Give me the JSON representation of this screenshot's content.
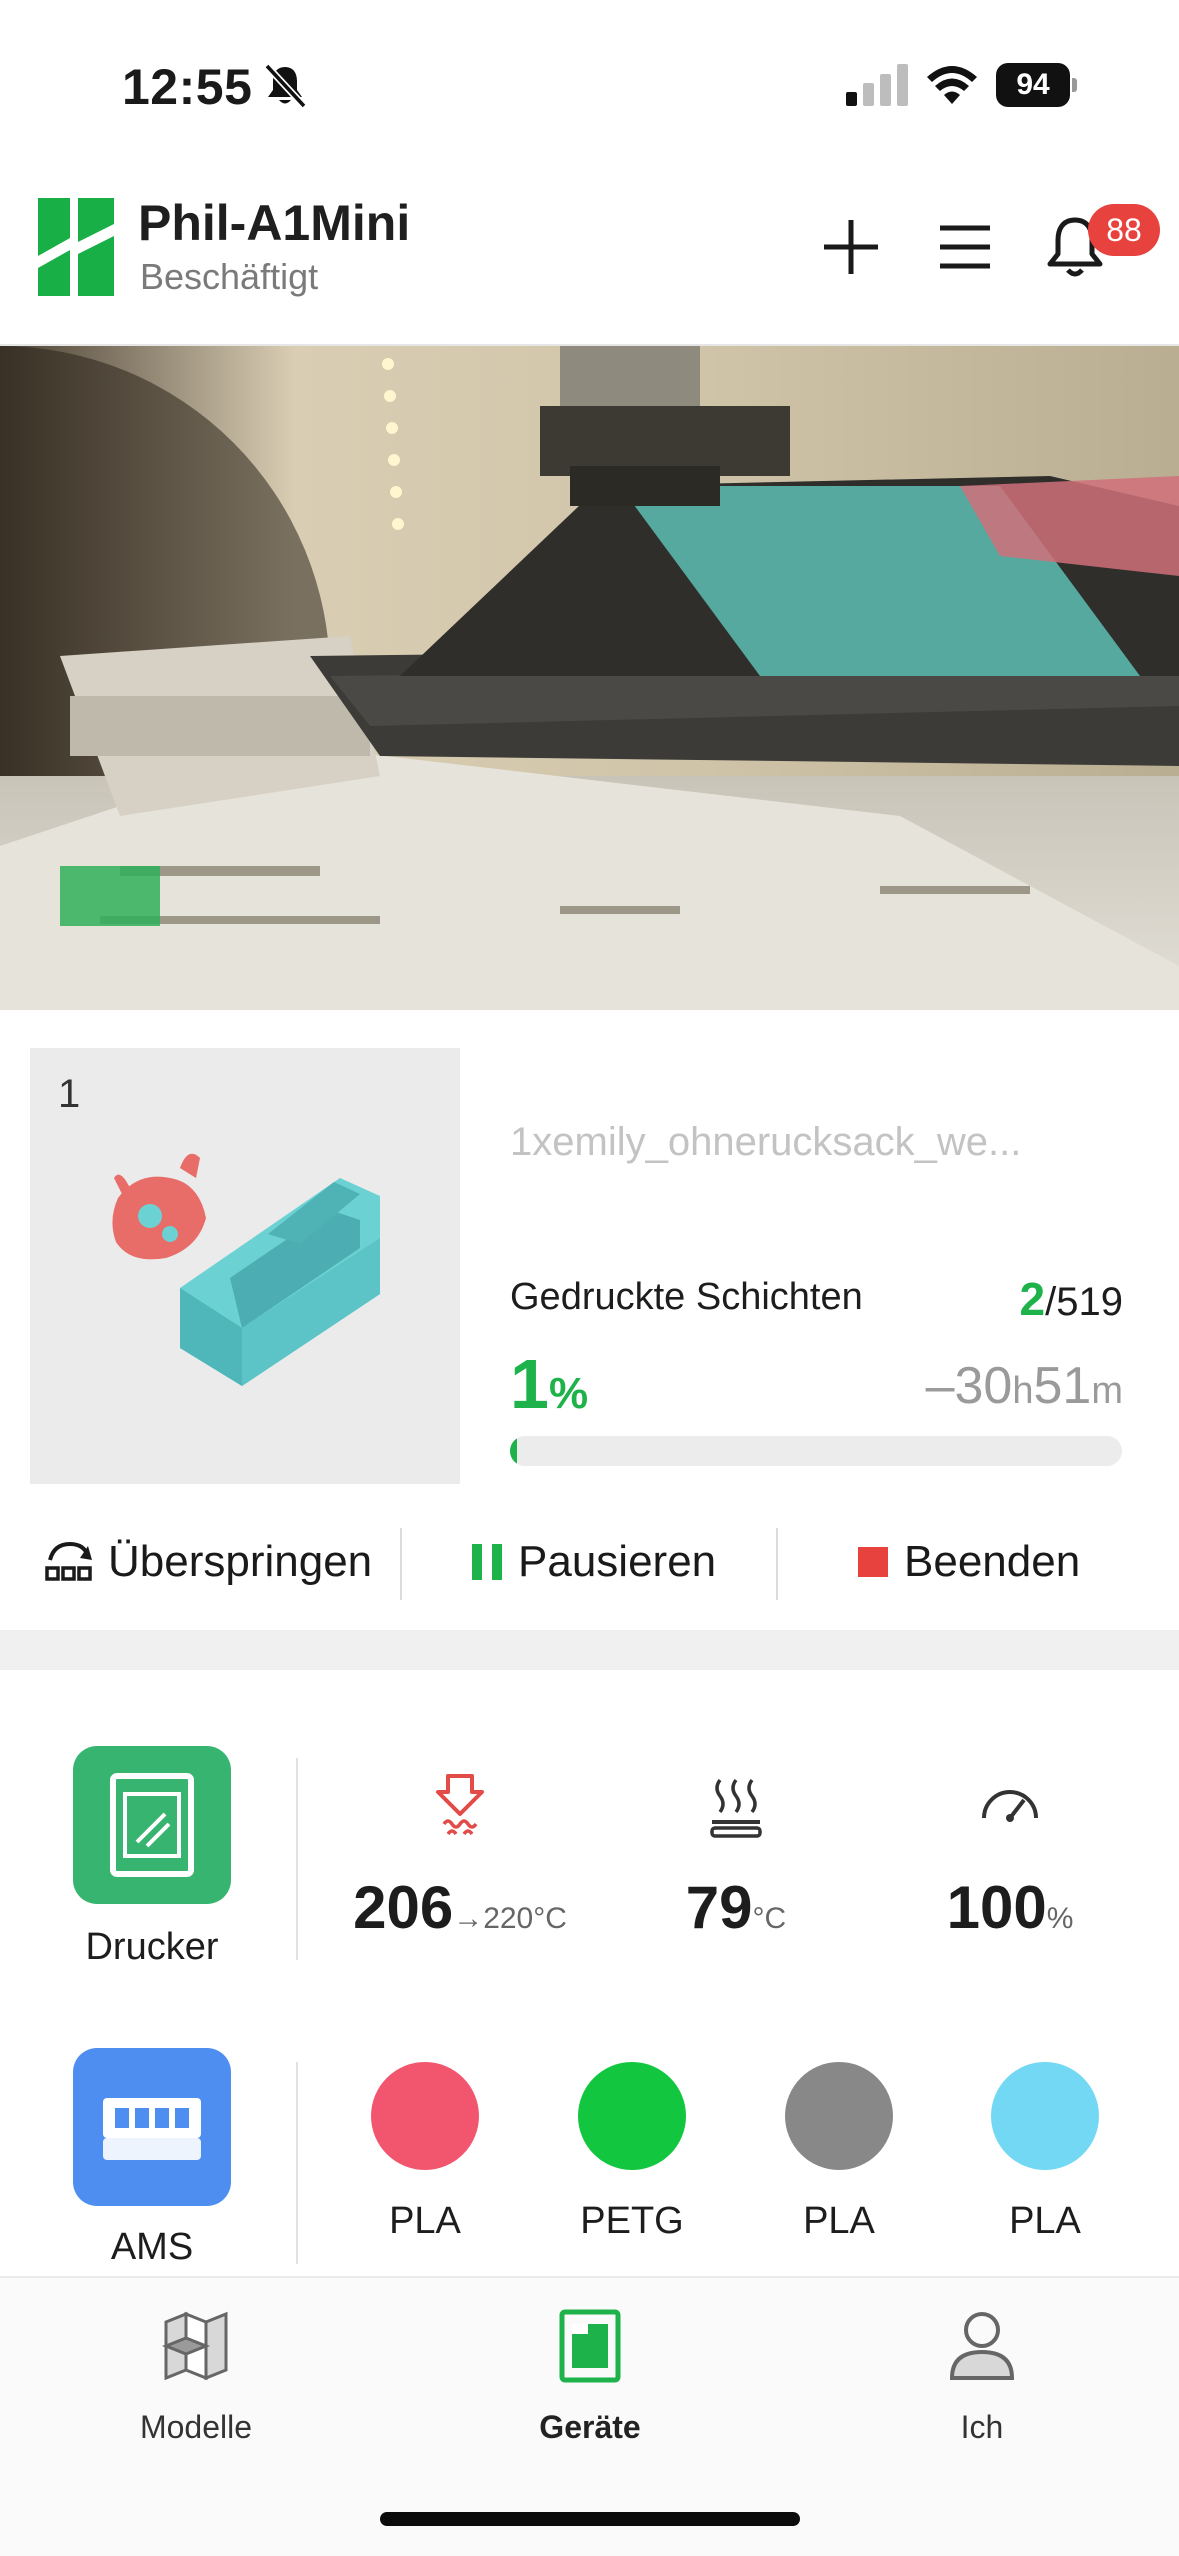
{
  "status_bar": {
    "time": "12:55",
    "battery": "94",
    "icons": [
      "bell-slash-icon",
      "signal-icon",
      "wifi-icon",
      "battery-icon"
    ]
  },
  "header": {
    "printer_name": "Phil-A1Mini",
    "printer_status": "Beschäftigt",
    "notification_count": "88",
    "icons": [
      "plus-icon",
      "menu-icon",
      "bell-icon"
    ]
  },
  "job": {
    "plate_number": "1",
    "filename": "1xemily_ohnerucksack_we...",
    "layers_label": "Gedruckte Schichten",
    "layers_current": "2",
    "layers_total": "/519",
    "progress_value": "1",
    "progress_unit": "%",
    "progress_fraction": 0.01,
    "remaining_prefix": "–30",
    "remaining_h_unit": "h",
    "remaining_minutes": "51",
    "remaining_m_unit": "m",
    "actions": {
      "skip": "Überspringen",
      "pause": "Pausieren",
      "stop": "Beenden"
    }
  },
  "stats": {
    "printer_tile_label": "Drucker",
    "nozzle_temp": "206",
    "nozzle_target": "→220°C",
    "bed_temp": "79",
    "bed_unit": "°C",
    "speed": "100",
    "speed_unit": "%",
    "ams_tile_label": "AMS",
    "filaments": [
      {
        "type": "PLA",
        "color": "#f2566e"
      },
      {
        "type": "PETG",
        "color": "#12c73f"
      },
      {
        "type": "PLA",
        "color": "#888888"
      },
      {
        "type": "PLA",
        "color": "#73d8f3"
      }
    ]
  },
  "colors": {
    "accent": "#1db24a",
    "stop": "#e8423f",
    "printer_tile": "#37b46f",
    "ams_tile": "#4d8ef0"
  },
  "bottom_nav": {
    "items": [
      {
        "label": "Modelle"
      },
      {
        "label": "Geräte",
        "active": true
      },
      {
        "label": "Ich"
      }
    ]
  }
}
